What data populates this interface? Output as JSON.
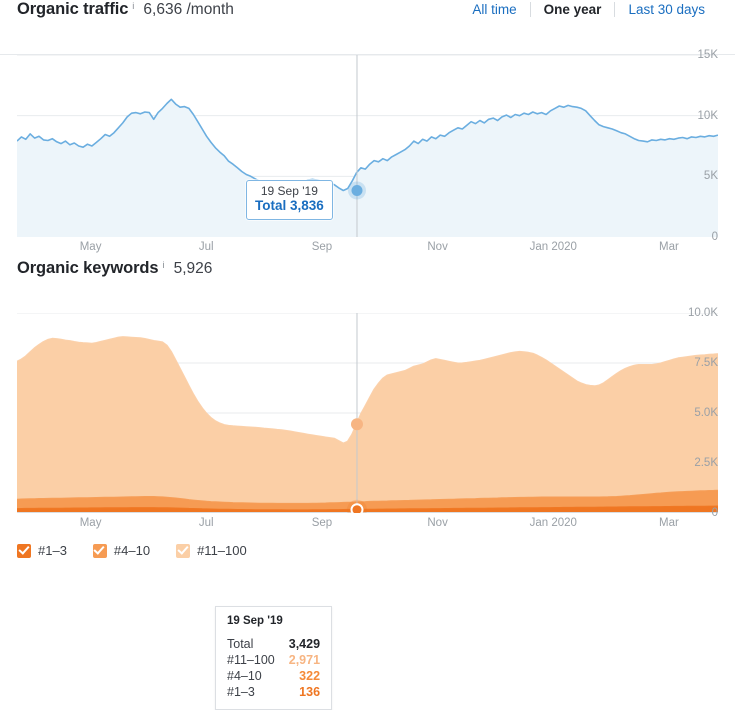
{
  "traffic": {
    "title": "Organic traffic",
    "info_icon": "info-icon",
    "value": "6,636 /month",
    "ranges": [
      {
        "label": "All time",
        "active": false
      },
      {
        "label": "One year",
        "active": true
      },
      {
        "label": "Last 30 days",
        "active": false
      }
    ],
    "tooltip": {
      "date": "19 Sep '19",
      "total_label": "Total",
      "total_value": "3,836",
      "combined": "Total 3,836"
    },
    "colors": {
      "line": "#6BAEE0",
      "fill": "#EDF5FA",
      "marker": "#6BAEE0",
      "link": "#1A6EC0"
    }
  },
  "keywords": {
    "title": "Organic keywords",
    "info_icon": "info-icon",
    "value": "5,926",
    "tooltip": {
      "date": "19 Sep '19",
      "rows": [
        {
          "label": "Total",
          "value": "3,429",
          "color": "#22252a"
        },
        {
          "label": "#11–100",
          "value": "2,971",
          "color": "#F7B583"
        },
        {
          "label": "#4–10",
          "value": "322",
          "color": "#F58A38"
        },
        {
          "label": "#1–3",
          "value": "136",
          "color": "#EF7622"
        }
      ]
    },
    "legend": [
      {
        "label": "#1–3",
        "color": "#EF7622",
        "checked": true
      },
      {
        "label": "#4–10",
        "color": "#F69B53",
        "checked": true
      },
      {
        "label": "#11–100",
        "color": "#FBCFA6",
        "checked": true
      }
    ]
  },
  "chart_data": [
    {
      "type": "line",
      "title": "Organic traffic",
      "xlabel": "",
      "ylabel": "",
      "ylim": [
        0,
        15000
      ],
      "yticks": [
        "0",
        "5K",
        "10K",
        "15K"
      ],
      "ytick_values": [
        0,
        5000,
        10000,
        15000
      ],
      "xticks": [
        "May",
        "Jul",
        "Sep",
        "Nov",
        "Jan 2020",
        "Mar"
      ],
      "xtick_positions": [
        0.105,
        0.27,
        0.435,
        0.6,
        0.765,
        0.93
      ],
      "grid": true,
      "legend_position": "none",
      "highlight_x": 0.485,
      "highlight_label": "19 Sep '19",
      "highlight_value": 3836,
      "series": [
        {
          "name": "Organic traffic",
          "values": [
            7900,
            8250,
            8050,
            8500,
            8150,
            8300,
            8000,
            7950,
            8100,
            7850,
            7700,
            7900,
            7600,
            7750,
            7500,
            7400,
            7650,
            7500,
            7800,
            8100,
            8450,
            8300,
            8600,
            9000,
            9400,
            9900,
            10200,
            10250,
            10150,
            10300,
            10250,
            9700,
            10250,
            10600,
            11000,
            11350,
            10950,
            10700,
            10750,
            10600,
            10100,
            9500,
            8900,
            8300,
            7800,
            7350,
            7000,
            6700,
            6250,
            6000,
            5700,
            5400,
            5150,
            5000,
            4800,
            4600,
            4450,
            4350,
            4200,
            4350,
            4500,
            4300,
            4200,
            4150,
            4300,
            4500,
            4700,
            4750,
            4700,
            4600,
            4500,
            4450,
            4300,
            4050,
            3836,
            4000,
            4600,
            5300,
            5700,
            5600,
            6000,
            6300,
            6200,
            6450,
            6300,
            6600,
            6800,
            7000,
            7200,
            7500,
            7900,
            7700,
            8050,
            7900,
            8250,
            8100,
            8400,
            8300,
            8600,
            8800,
            9000,
            8900,
            9200,
            9500,
            9350,
            9600,
            9400,
            9700,
            9800,
            9600,
            9900,
            10050,
            9850,
            10100,
            10000,
            10200,
            10100,
            10300,
            10150,
            10250,
            10100,
            10400,
            10600,
            10800,
            10700,
            10850,
            10750,
            10700,
            10600,
            10400,
            10000,
            9600,
            9250,
            9100,
            9000,
            8900,
            8750,
            8600,
            8500,
            8300,
            8100,
            7950,
            7900,
            7850,
            8000,
            7950,
            8050,
            8000,
            8100,
            8050,
            8150,
            8200,
            8100,
            8250,
            8200,
            8300,
            8250,
            8350,
            8300,
            8400
          ]
        }
      ]
    },
    {
      "type": "area",
      "stacked": true,
      "title": "Organic keywords",
      "xlabel": "",
      "ylabel": "",
      "ylim": [
        0,
        10000
      ],
      "yticks": [
        "0",
        "2.5K",
        "5.0K",
        "7.5K",
        "10.0K"
      ],
      "ytick_values": [
        0,
        2500,
        5000,
        7500,
        10000
      ],
      "xticks": [
        "May",
        "Jul",
        "Sep",
        "Nov",
        "Jan 2020",
        "Mar"
      ],
      "xtick_positions": [
        0.105,
        0.27,
        0.435,
        0.6,
        0.765,
        0.93
      ],
      "grid": true,
      "legend_position": "bottom",
      "highlight_x": 0.485,
      "highlight_label": "19 Sep '19",
      "highlight_total": 3429,
      "series": [
        {
          "name": "#1–3",
          "color": "#EF7622",
          "values": [
            200,
            205,
            208,
            210,
            212,
            215,
            214,
            216,
            218,
            220,
            222,
            224,
            226,
            228,
            230,
            229,
            231,
            233,
            235,
            236,
            238,
            240,
            242,
            243,
            245,
            246,
            248,
            249,
            250,
            250,
            249,
            248,
            246,
            244,
            240,
            236,
            230,
            224,
            218,
            212,
            205,
            198,
            192,
            186,
            180,
            176,
            172,
            168,
            164,
            160,
            157,
            154,
            151,
            148,
            146,
            144,
            142,
            141,
            140,
            139,
            138,
            137,
            137,
            136,
            136,
            136,
            137,
            138,
            140,
            142,
            145,
            148,
            150,
            152,
            155,
            158,
            160,
            163,
            166,
            168,
            170,
            172,
            174,
            176,
            178,
            180,
            182,
            184,
            186,
            188,
            190,
            192,
            194,
            196,
            198,
            200,
            202,
            204,
            206,
            208,
            210,
            212,
            214,
            216,
            218,
            220,
            222,
            224,
            226,
            228,
            230,
            232,
            234,
            236,
            238,
            240,
            242,
            244,
            246,
            248,
            250,
            252,
            254,
            256,
            258,
            260,
            262,
            264,
            266,
            268,
            270,
            272,
            274,
            276,
            278,
            280,
            282,
            284,
            286,
            288,
            290,
            292,
            294,
            296,
            298,
            300,
            302,
            304,
            306,
            308,
            310,
            312,
            314,
            316,
            318,
            320,
            322,
            324,
            326,
            328
          ]
        },
        {
          "name": "#4–10",
          "color": "#F69B53",
          "values": [
            470,
            475,
            478,
            480,
            485,
            488,
            490,
            492,
            495,
            498,
            500,
            503,
            505,
            508,
            510,
            512,
            515,
            518,
            520,
            523,
            525,
            528,
            530,
            533,
            535,
            538,
            540,
            545,
            550,
            555,
            558,
            555,
            548,
            540,
            530,
            515,
            500,
            480,
            460,
            440,
            420,
            405,
            392,
            380,
            372,
            365,
            358,
            352,
            346,
            342,
            338,
            335,
            332,
            330,
            328,
            326,
            325,
            324,
            323,
            322,
            322,
            322,
            322,
            322,
            322,
            322,
            324,
            326,
            328,
            332,
            336,
            340,
            345,
            350,
            355,
            360,
            366,
            372,
            378,
            382,
            388,
            392,
            396,
            400,
            404,
            408,
            412,
            416,
            420,
            424,
            428,
            432,
            436,
            440,
            444,
            448,
            452,
            456,
            460,
            464,
            468,
            472,
            476,
            480,
            484,
            488,
            492,
            496,
            500,
            504,
            508,
            512,
            516,
            518,
            520,
            522,
            524,
            526,
            528,
            530,
            528,
            526,
            524,
            522,
            520,
            518,
            516,
            514,
            512,
            510,
            508,
            506,
            505,
            508,
            512,
            518,
            525,
            535,
            548,
            562,
            578,
            595,
            612,
            630,
            648,
            665,
            680,
            695,
            708,
            720,
            730,
            740,
            748,
            755,
            762,
            768,
            774,
            780,
            786,
            792
          ]
        },
        {
          "name": "#11–100",
          "color": "#FBCFA6",
          "values": [
            6900,
            7000,
            7150,
            7350,
            7550,
            7700,
            7850,
            7950,
            8000,
            7980,
            7950,
            7900,
            7870,
            7820,
            7780,
            7760,
            7740,
            7720,
            7750,
            7800,
            7850,
            7900,
            7950,
            8000,
            8020,
            8000,
            7980,
            7960,
            7940,
            7900,
            7850,
            7800,
            7780,
            7750,
            7600,
            7300,
            6900,
            6500,
            6100,
            5700,
            5300,
            4950,
            4650,
            4400,
            4200,
            4050,
            3950,
            3880,
            3850,
            3840,
            3830,
            3820,
            3810,
            3800,
            3790,
            3780,
            3760,
            3740,
            3720,
            3700,
            3680,
            3650,
            3620,
            3580,
            3540,
            3500,
            3460,
            3420,
            3380,
            3340,
            3300,
            3260,
            3220,
            3100,
            2971,
            3050,
            3400,
            3900,
            4400,
            4800,
            5200,
            5600,
            5900,
            6150,
            6300,
            6350,
            6400,
            6450,
            6500,
            6600,
            6700,
            6750,
            6800,
            6900,
            7000,
            7050,
            7000,
            6950,
            6900,
            6850,
            6800,
            6800,
            6820,
            6850,
            6880,
            6900,
            6950,
            7000,
            7050,
            7100,
            7150,
            7200,
            7250,
            7280,
            7300,
            7280,
            7250,
            7200,
            7100,
            6980,
            6850,
            6700,
            6550,
            6400,
            6250,
            6100,
            5950,
            5800,
            5700,
            5620,
            5580,
            5560,
            5600,
            5700,
            5850,
            6000,
            6150,
            6280,
            6380,
            6450,
            6500,
            6520,
            6500,
            6480,
            6460,
            6470,
            6500,
            6550,
            6600,
            6650,
            6700,
            6720,
            6740,
            6760,
            6780,
            6790,
            6800,
            6810,
            6820,
            6830
          ]
        }
      ]
    }
  ]
}
